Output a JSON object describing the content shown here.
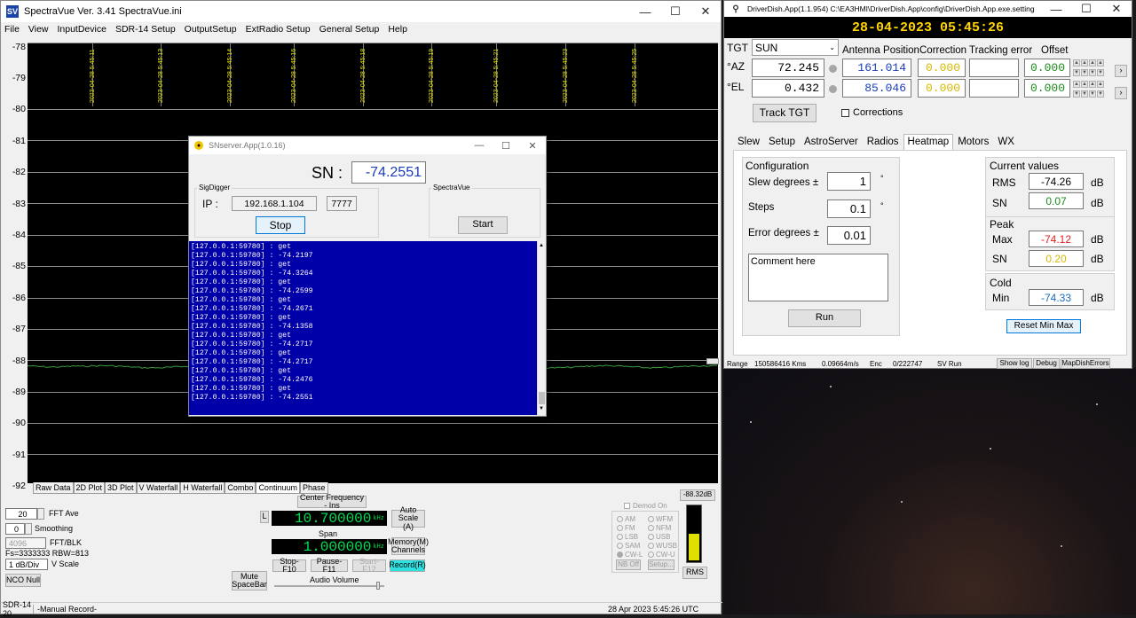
{
  "spectravue": {
    "title": "SpectraVue Ver. 3.41  SpectraVue.ini",
    "menu": [
      "File",
      "View",
      "InputDevice",
      "SDR-14 Setup",
      "OutputSetup",
      "ExtRadio Setup",
      "General Setup",
      "Help"
    ],
    "y_axis_labels": [
      "-78",
      "-79",
      "-80",
      "-81",
      "-82",
      "-83",
      "-84",
      "-85",
      "-86",
      "-87",
      "-88",
      "-89",
      "-90",
      "-91",
      "-92"
    ],
    "time_labels": [
      "2023-04-28 5:45:11",
      "2023-04-28 5:45:13",
      "2023-04-28 5:45:14",
      "2023-04-28 5:45:16",
      "2023-04-28 5:45:18",
      "2023-04-28 5:45:19",
      "2023-04-28 5:45:21",
      "2023-04-28 5:45:23",
      "2023-04-28 5:45:25"
    ],
    "plot_tabs": [
      "Raw Data",
      "2D Plot",
      "3D Plot",
      "V Waterfall",
      "H Waterfall",
      "Combo",
      "Continuum",
      "Phase"
    ],
    "active_tab": "Continuum",
    "fft_ave_value": "20",
    "fft_ave_label": "FFT Ave",
    "smoothing_value": "0",
    "smoothing_label": "Smoothing",
    "fft_blk_value": "4096",
    "fft_blk_label": "FFT/BLK",
    "fs_text": "Fs=3333333 RBW=813",
    "vscale_value": "1 dB/Div",
    "vscale_label": "V Scale",
    "nco_null": "NCO Null",
    "mute": "Mute SpaceBar",
    "center_freq_label": "Center Frequency - Ins",
    "l_button": "L",
    "center_freq": "10.700000",
    "khz": "kHz",
    "span_label": "Span",
    "span": "1.000000",
    "auto_scale": "Auto Scale (A)",
    "memory_channels": "Memory(M) Channels",
    "stop_btn": "Stop-F10",
    "pause_btn": "Pause-F11",
    "start_btn": "Start-F12",
    "record_btn": "Record(R)",
    "audio_volume": "Audio Volume",
    "demod_on": "Demod On",
    "demod_modes": [
      "AM",
      "WFM",
      "FM",
      "NFM",
      "LSB",
      "USB",
      "SAM",
      "WUSB",
      "CW-L",
      "CW-U"
    ],
    "nb_off": "NB Off",
    "setup": "Setup...",
    "db_readout": "-88.32dB",
    "rms": "RMS",
    "status_left": "SDR-14 20",
    "status_mid": "-Manual Record-",
    "status_right": "28 Apr 2023  5:45:26 UTC",
    "trace_level_db": -88.3
  },
  "snserver": {
    "title": "SNserver.App(1.0.16)",
    "sn_label": "SN :",
    "sn_value": "-74.2551",
    "sigdigger_label": "SigDigger",
    "ip_label": "IP :",
    "ip_value": "192.168.1.104",
    "port_value": "7777",
    "stop": "Stop",
    "spectravue_label": "SpectraVue",
    "start": "Start",
    "log": "[127.0.0.1:59780] : get\n[127.0.0.1:59780] : -74.2197\n[127.0.0.1:59780] : get\n[127.0.0.1:59780] : -74.3264\n[127.0.0.1:59780] : get\n[127.0.0.1:59780] : -74.2599\n[127.0.0.1:59780] : get\n[127.0.0.1:59780] : -74.2671\n[127.0.0.1:59780] : get\n[127.0.0.1:59780] : -74.1358\n[127.0.0.1:59780] : get\n[127.0.0.1:59780] : -74.2717\n[127.0.0.1:59780] : get\n[127.0.0.1:59780] : -74.2717\n[127.0.0.1:59780] : get\n[127.0.0.1:59780] : -74.2476\n[127.0.0.1:59780] : get\n[127.0.0.1:59780] : -74.2551"
  },
  "driverdish": {
    "title": "DriverDish.App(1.1.954) C:\\EA3HMI\\DriverDish.App\\config\\DriverDish.App.exe.setting",
    "clock": "28-04-2023 05:45:26",
    "tgt_label": "TGT",
    "target": "SUN",
    "col_antenna": "Antenna Position",
    "col_correction": "Correction",
    "col_tracking": "Tracking error",
    "col_offset": "Offset",
    "az_label": "°AZ",
    "el_label": "°EL",
    "az_target": "72.245",
    "el_target": "0.432",
    "az_position": "161.014",
    "el_position": "85.046",
    "az_correction": "0.000",
    "el_correction": "0.000",
    "az_tracking": "",
    "el_tracking": "",
    "az_offset": "0.000",
    "el_offset": "0.000",
    "track_tgt": "Track TGT",
    "corrections": "Corrections",
    "tabs": [
      "Slew",
      "Setup",
      "AstroServer",
      "Radios",
      "Heatmap",
      "Motors",
      "WX"
    ],
    "active_tab": "Heatmap",
    "configuration": "Configuration",
    "slew_label": "Slew degrees ±",
    "slew_value": "1",
    "steps_label": "Steps",
    "steps_value": "0.1",
    "error_label": "Error degrees ±",
    "error_value": "0.01",
    "degree_sign": "°",
    "comment": "Comment here",
    "run": "Run",
    "current_values": "Current values",
    "rms_label": "RMS",
    "rms_value": "-74.26",
    "sn_label": "SN",
    "sn_current": "0.07",
    "peak": "Peak",
    "max_label": "Max",
    "max_value": "-74.12",
    "sn_peak": "0.20",
    "cold": "Cold",
    "min_label": "Min",
    "min_value": "-74.33",
    "db": "dB",
    "reset": "Reset Min  Max",
    "status_range_label": "Range",
    "status_range": "150586416 Kms",
    "status_speed": "0.09664m/s",
    "status_enc_label": "Enc",
    "status_enc": "0/222747",
    "status_sv": "SV Run",
    "show_log": "Show log",
    "debug": "Debug",
    "map_errors": "MapDishErrors"
  }
}
